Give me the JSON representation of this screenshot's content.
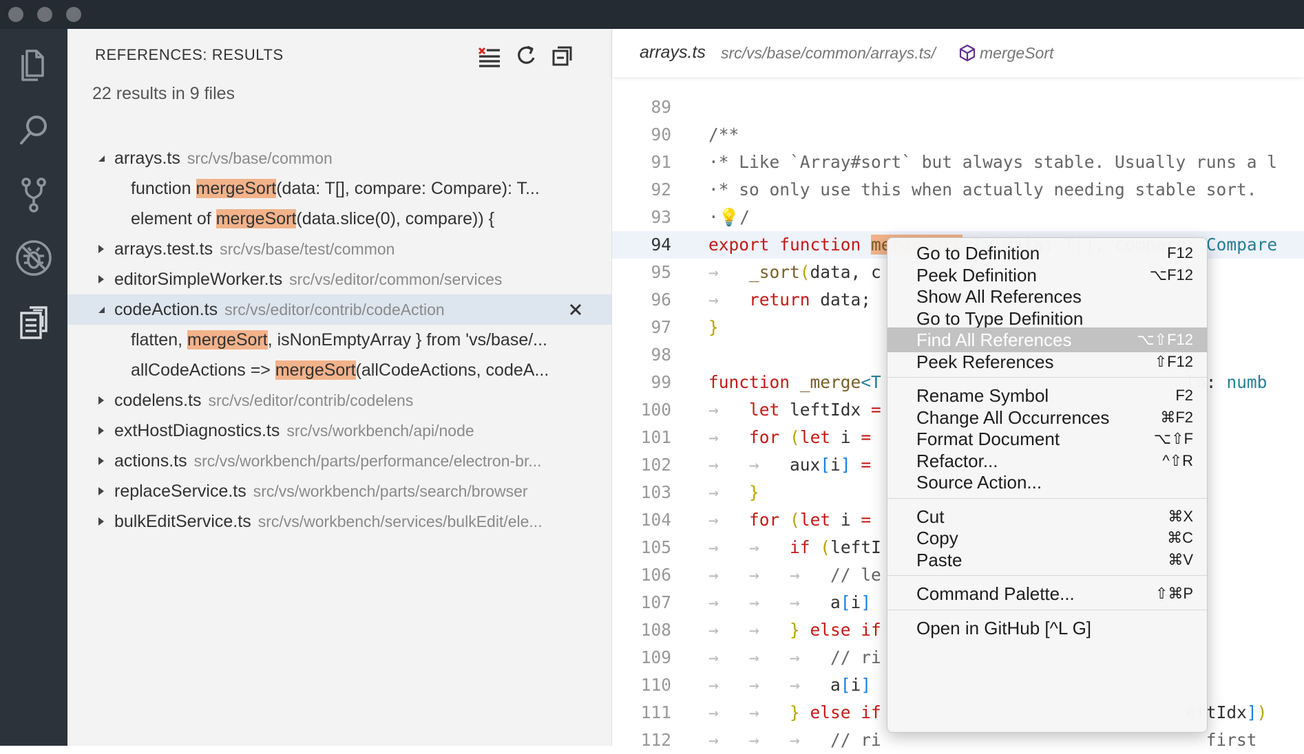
{
  "sidebar": {
    "title": "REFERENCES: RESULTS",
    "summary": "22 results in 9 files",
    "tree": [
      {
        "kind": "file",
        "expanded": true,
        "name": "arrays.ts",
        "path": "src/vs/base/common"
      },
      {
        "kind": "match",
        "before": "function ",
        "match": "mergeSort",
        "after": "(data: T[], compare: Compare): T..."
      },
      {
        "kind": "match",
        "before": "element of ",
        "match": "mergeSort",
        "after": "(data.slice(0), compare)) {"
      },
      {
        "kind": "file",
        "expanded": false,
        "name": "arrays.test.ts",
        "path": "src/vs/base/test/common"
      },
      {
        "kind": "file",
        "expanded": false,
        "name": "editorSimpleWorker.ts",
        "path": "src/vs/editor/common/services"
      },
      {
        "kind": "file",
        "expanded": true,
        "selected": true,
        "name": "codeAction.ts",
        "path": "src/vs/editor/contrib/codeAction"
      },
      {
        "kind": "match",
        "before": "flatten, ",
        "match": "mergeSort",
        "after": ", isNonEmptyArray } from 'vs/base/..."
      },
      {
        "kind": "match",
        "before": "allCodeActions => ",
        "match": "mergeSort",
        "after": "(allCodeActions, codeA..."
      },
      {
        "kind": "file",
        "expanded": false,
        "name": "codelens.ts",
        "path": "src/vs/editor/contrib/codelens"
      },
      {
        "kind": "file",
        "expanded": false,
        "name": "extHostDiagnostics.ts",
        "path": "src/vs/workbench/api/node"
      },
      {
        "kind": "file",
        "expanded": false,
        "name": "actions.ts",
        "path": "src/vs/workbench/parts/performance/electron-br..."
      },
      {
        "kind": "file",
        "expanded": false,
        "name": "replaceService.ts",
        "path": "src/vs/workbench/parts/search/browser"
      },
      {
        "kind": "file",
        "expanded": false,
        "name": "bulkEditService.ts",
        "path": "src/vs/workbench/services/bulkEdit/ele..."
      }
    ]
  },
  "editor": {
    "breadcrumb": {
      "file": "arrays.ts",
      "path": "src/vs/base/common/arrays.ts/",
      "symbol": "mergeSort"
    },
    "current_line": "94",
    "lines": [
      {
        "n": "89",
        "html": ""
      },
      {
        "n": "90",
        "html": "<span class='c-cm'>/**</span>"
      },
      {
        "n": "91",
        "html": "<span class='c-cm'>·* Like `Array#sort` but always stable. Usually runs a l</span>"
      },
      {
        "n": "92",
        "html": "<span class='c-cm'>·* so only use this when actually needing stable sort.</span>"
      },
      {
        "n": "93",
        "html": "<span class='c-cm'>·💡/</span>"
      },
      {
        "n": "94",
        "html": "<span class='c-kw'>export function </span><span class='c-fn sym-hl'>mergeSort</span><span class='c-ty'>&lt;T&gt;</span><span class='c-br'>(</span>data: <span class='c-ty'>T</span><span class='c-bl'>[]</span>, compare: <span class='c-ty'>Compare</span>"
      },
      {
        "n": "95",
        "html": "<span class='c-ws'>→   </span><span class='c-fn'>_sort</span><span class='c-br'>(</span>data, c                          <span class='c-bl'>]</span><span class='c-br'>)</span>;"
      },
      {
        "n": "96",
        "html": "<span class='c-ws'>→   </span><span class='c-kw'>return</span> data;"
      },
      {
        "n": "97",
        "html": "<span class='c-br'>}</span>"
      },
      {
        "n": "98",
        "html": ""
      },
      {
        "n": "99",
        "html": "<span class='c-kw'>function </span><span class='c-fn'>_merge</span><span class='c-ty'>&lt;T</span>                              lo: <span class='c-ty'>numb</span>"
      },
      {
        "n": "100",
        "html": "<span class='c-ws'>→   </span><span class='c-kw'>let</span> leftIdx <span class='c-kw'>=</span>"
      },
      {
        "n": "101",
        "html": "<span class='c-ws'>→   </span><span class='c-kw'>for</span> <span class='c-br'>(</span><span class='c-kw'>let</span> i <span class='c-kw'>=</span>"
      },
      {
        "n": "102",
        "html": "<span class='c-ws'>→   →   </span>aux<span class='c-bl'>[</span>i<span class='c-bl'>]</span> <span class='c-kw'>=</span>"
      },
      {
        "n": "103",
        "html": "<span class='c-ws'>→   </span><span class='c-br'>}</span>"
      },
      {
        "n": "104",
        "html": "<span class='c-ws'>→   </span><span class='c-kw'>for</span> <span class='c-br'>(</span><span class='c-kw'>let</span> i <span class='c-kw'>=</span>"
      },
      {
        "n": "105",
        "html": "<span class='c-ws'>→   →   </span><span class='c-kw'>if</span> <span class='c-br'>(</span>leftI"
      },
      {
        "n": "106",
        "html": "<span class='c-ws'>→   →   →   </span><span class='c-cm'>// le</span>"
      },
      {
        "n": "107",
        "html": "<span class='c-ws'>→   →   →   </span>a<span class='c-bl'>[</span>i<span class='c-bl'>]</span>"
      },
      {
        "n": "108",
        "html": "<span class='c-ws'>→   →   </span><span class='c-br'>}</span> <span class='c-kw'>else if</span>"
      },
      {
        "n": "109",
        "html": "<span class='c-ws'>→   →   →   </span><span class='c-cm'>// ri</span>"
      },
      {
        "n": "110",
        "html": "<span class='c-ws'>→   →   →   </span>a<span class='c-bl'>[</span>i<span class='c-bl'>]</span>"
      },
      {
        "n": "111",
        "html": "<span class='c-ws'>→   →   </span><span class='c-br'>}</span> <span class='c-kw'>else if</span>                              eftIdx<span class='c-bl'>]</span><span class='c-br'>)</span>"
      },
      {
        "n": "112",
        "html": "<span class='c-ws'>→   →   →   </span><span class='c-cm'>// ri                                first</span>"
      }
    ]
  },
  "context_menu": {
    "items": [
      {
        "type": "item",
        "label": "Go to Definition",
        "key": "F12"
      },
      {
        "type": "item",
        "label": "Peek Definition",
        "key": "⌥F12"
      },
      {
        "type": "item",
        "label": "Show All References",
        "key": ""
      },
      {
        "type": "item",
        "label": "Go to Type Definition",
        "key": ""
      },
      {
        "type": "item",
        "label": "Find All References",
        "key": "⌥⇧F12",
        "highlighted": true
      },
      {
        "type": "item",
        "label": "Peek References",
        "key": "⇧F12"
      },
      {
        "type": "separator"
      },
      {
        "type": "item",
        "label": "Rename Symbol",
        "key": "F2"
      },
      {
        "type": "item",
        "label": "Change All Occurrences",
        "key": "⌘F2"
      },
      {
        "type": "item",
        "label": "Format Document",
        "key": "⌥⇧F"
      },
      {
        "type": "item",
        "label": "Refactor...",
        "key": "^⇧R"
      },
      {
        "type": "item",
        "label": "Source Action...",
        "key": ""
      },
      {
        "type": "separator"
      },
      {
        "type": "item",
        "label": "Cut",
        "key": "⌘X"
      },
      {
        "type": "item",
        "label": "Copy",
        "key": "⌘C"
      },
      {
        "type": "item",
        "label": "Paste",
        "key": "⌘V"
      },
      {
        "type": "separator"
      },
      {
        "type": "item",
        "label": "Command Palette...",
        "key": "⇧⌘P"
      },
      {
        "type": "separator"
      },
      {
        "type": "item",
        "label": "Open in GitHub [^L G]",
        "key": ""
      }
    ]
  },
  "colors": {
    "titlebar": "#252b33",
    "activity_bar": "#2c333b",
    "sidebar": "#f3f3f3",
    "selection": "#dde5ee",
    "match_highlight": "#f2b28a",
    "menu_highlight": "#c2c2c2"
  },
  "icons": {
    "activity_bar": [
      "files-icon",
      "search-icon",
      "source-control-icon",
      "debug-icon",
      "references-icon"
    ],
    "sidebar_tools": [
      "clear-results-icon",
      "refresh-icon",
      "collapse-all-icon"
    ]
  }
}
